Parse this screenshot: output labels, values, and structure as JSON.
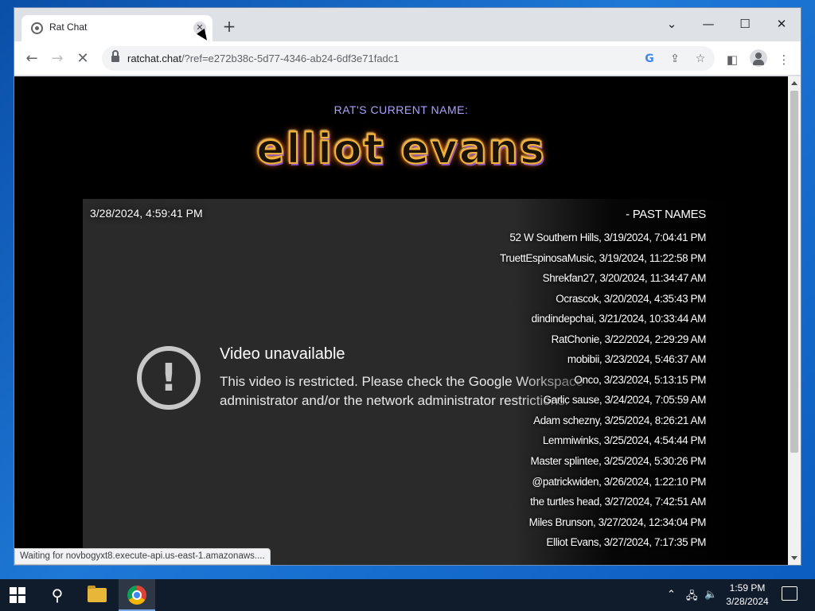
{
  "browser": {
    "tab_title": "Rat Chat",
    "tab_close": "✕",
    "new_tab": "+",
    "url_domain": "ratchat.chat",
    "url_path": "/?ref=e272b38c-5d77-4346-ab24-6df3e71fadc1",
    "status_text": "Waiting for novbogyxt8.execute-api.us-east-1.amazonaws...."
  },
  "page": {
    "current_name_label": "RAT'S CURRENT NAME:",
    "current_name": "elliot evans",
    "timestamp": "3/28/2024, 4:59:41 PM",
    "video_error": {
      "title": "Video unavailable",
      "message": "This video is restricted. Please check the Google Workspace administrator and/or the network administrator restrictions."
    },
    "past_names_header": "- PAST NAMES",
    "past_names": [
      "52 W Southern Hills, 3/19/2024, 7:04:41 PM",
      "TruettEspinosaMusic, 3/19/2024, 11:22:58 PM",
      "Shrekfan27, 3/20/2024, 11:34:47 AM",
      "Ocrascok, 3/20/2024, 4:35:43 PM",
      "dindindepchai, 3/21/2024, 10:33:44 AM",
      "RatChonie, 3/22/2024, 2:29:29 AM",
      "mobibii, 3/23/2024, 5:46:37 AM",
      "Onco, 3/23/2024, 5:13:15 PM",
      "Garlic sause, 3/24/2024, 7:05:59 AM",
      "Adam schezny, 3/25/2024, 8:26:21 AM",
      "Lemmiwinks, 3/25/2024, 4:54:44 PM",
      "Master splintee, 3/25/2024, 5:30:26 PM",
      "@patrickwiden, 3/26/2024, 1:22:10 PM",
      "the turtles head, 3/27/2024, 7:42:51 AM",
      "Miles Brunson, 3/27/2024, 12:34:04 PM",
      "Elliot Evans, 3/27/2024, 7:17:35 PM"
    ]
  },
  "taskbar": {
    "time": "1:59 PM",
    "date": "3/28/2024"
  },
  "colors": {
    "page_bg": "#000000",
    "panel_bg": "#2a2a2a",
    "label_purple": "#a9a4ff"
  }
}
